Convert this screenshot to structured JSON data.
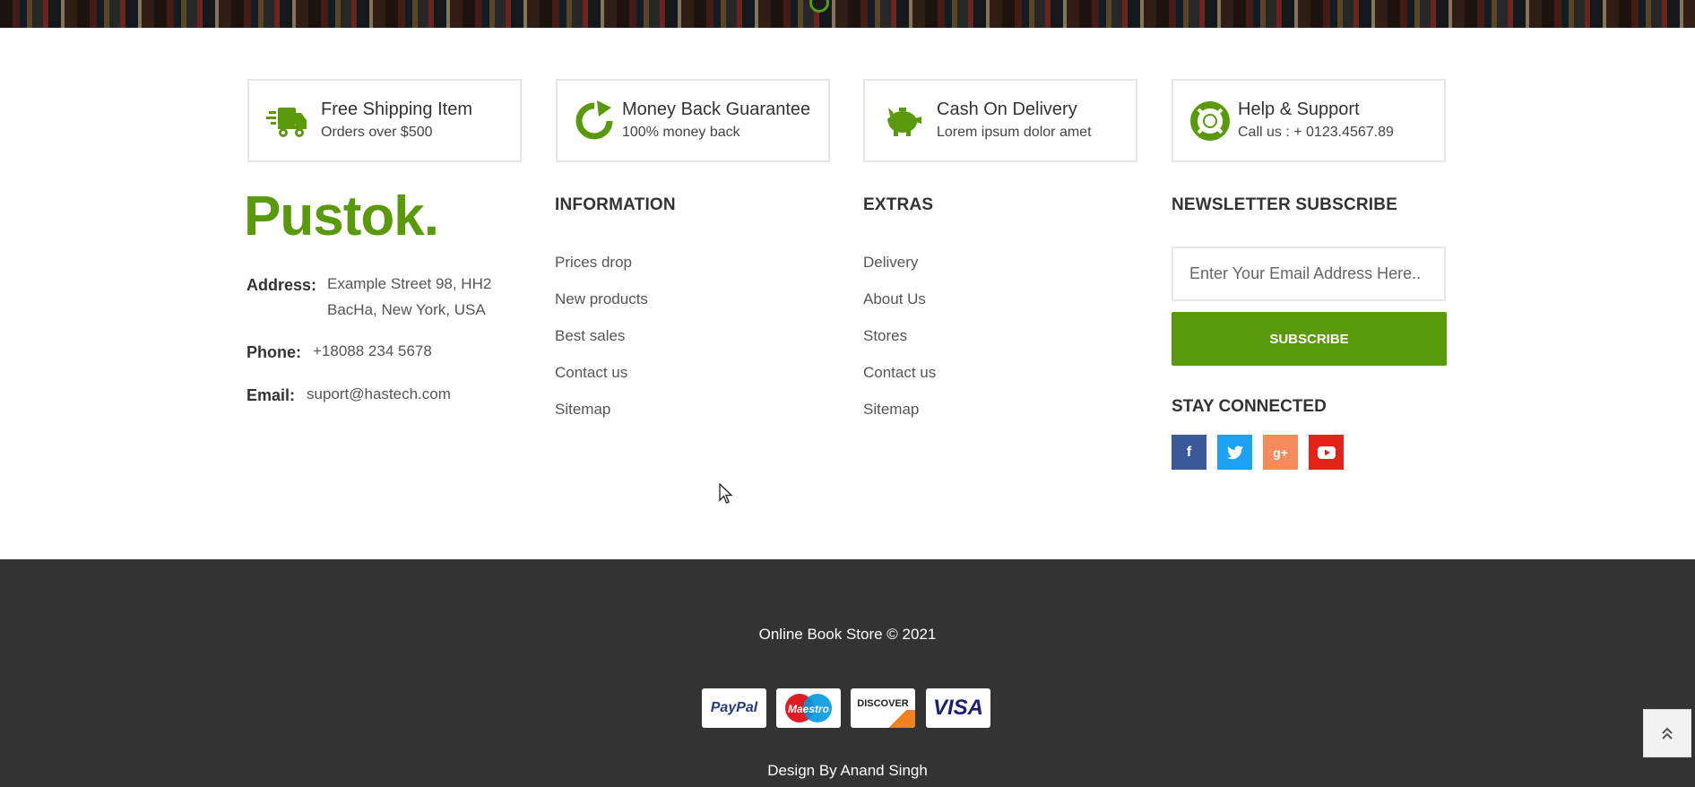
{
  "features": [
    {
      "icon": "truck-icon",
      "title": "Free Shipping Item",
      "subtitle": "Orders over $500"
    },
    {
      "icon": "refresh-icon",
      "title": "Money Back Guarantee",
      "subtitle": "100% money back"
    },
    {
      "icon": "piggy-bank-icon",
      "title": "Cash On Delivery",
      "subtitle": "Lorem ipsum dolor amet"
    },
    {
      "icon": "lifebuoy-icon",
      "title": "Help & Support",
      "subtitle": "Call us : + 0123.4567.89"
    }
  ],
  "brand": {
    "logo": "Pustok.",
    "color": "#5a9a0a"
  },
  "contact": {
    "address_label": "Address:",
    "address_line1": "Example Street 98, HH2",
    "address_line2": "BacHa, New York, USA",
    "phone_label": "Phone:",
    "phone": "+18088 234 5678",
    "email_label": "Email:",
    "email": "suport@hastech.com"
  },
  "information": {
    "heading": "INFORMATION",
    "links": [
      "Prices drop",
      "New products",
      "Best sales",
      "Contact us",
      "Sitemap"
    ]
  },
  "extras": {
    "heading": "EXTRAS",
    "links": [
      "Delivery",
      "About Us",
      "Stores",
      "Contact us",
      "Sitemap"
    ]
  },
  "newsletter": {
    "heading": "NEWSLETTER SUBSCRIBE",
    "placeholder": "Enter Your Email Address Here..",
    "button": "SUBSCRIBE"
  },
  "social": {
    "heading": "STAY CONNECTED",
    "items": [
      {
        "icon": "facebook-icon",
        "glyph": "f",
        "color": "#3b5998"
      },
      {
        "icon": "twitter-icon",
        "glyph": "t",
        "color": "#1da1f2"
      },
      {
        "icon": "google-plus-icon",
        "glyph": "g+",
        "color": "#f58a5c"
      },
      {
        "icon": "youtube-icon",
        "glyph": "▶",
        "color": "#e62117"
      }
    ]
  },
  "footer": {
    "copyright": "Online Book Store © 2021",
    "payments": [
      "PayPal",
      "Maestro",
      "DISCOVER",
      "VISA"
    ],
    "design_by": "Design By Anand Singh"
  },
  "colors": {
    "accent": "#5a9a0a",
    "footer_bg": "#333333"
  }
}
